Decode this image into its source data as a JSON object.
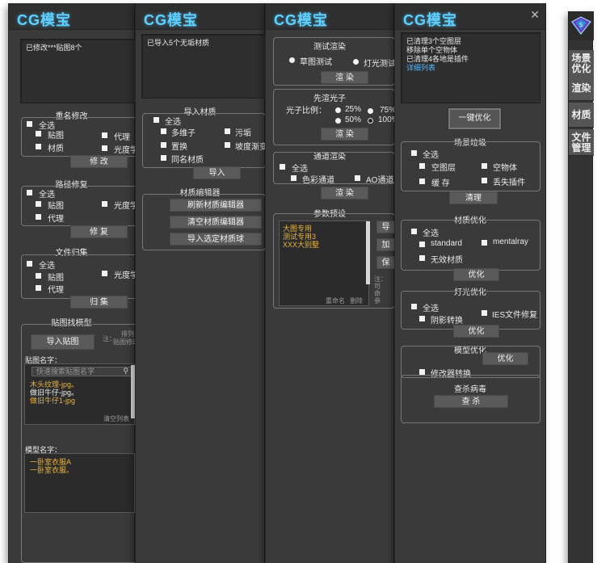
{
  "brand": {
    "logo_text": "CG模宝"
  },
  "panel1": {
    "log": "已修改***贴图8个",
    "rename": {
      "title": "重名修改",
      "select_all": "全选",
      "items": [
        "贴图",
        "代理",
        "材质",
        "光度学"
      ],
      "button": "修 改"
    },
    "path_repair": {
      "title": "路径修复",
      "select_all": "全选",
      "items": [
        "贴图",
        "光度学",
        "代理"
      ],
      "button": "修 复"
    },
    "file_collect": {
      "title": "文件归集",
      "select_all": "全选",
      "items": [
        "贴图",
        "光度学",
        "代理"
      ],
      "button": "归 集"
    },
    "find_model": {
      "title": "贴图找模型",
      "import_button": "导入贴图",
      "note1": "注：",
      "note2": "排列",
      "note3": "贴图修改",
      "map_name_label": "贴图名字：",
      "search_placeholder": "快速搜索贴图名字",
      "maps": [
        {
          "name": "木头纹理-jpg。",
          "style": "yel"
        },
        {
          "name": "做旧牛仔-jpg。",
          "style": "wht"
        },
        {
          "name": "做旧牛仔1-jpg",
          "style": "yel"
        }
      ],
      "clear_list": "清空列表",
      "model_name_label": "模型名字：",
      "models": [
        "一卧室衣服A",
        "一卧室衣服。"
      ]
    }
  },
  "panel2": {
    "log": "已导入5个无垢材质",
    "import_mat": {
      "title": "导入材质",
      "select_all": "全选",
      "items": [
        "多维子",
        "污垢",
        "置换",
        "坡度渐变",
        "同名材质"
      ],
      "button": "导入"
    },
    "mat_editor": {
      "title": "材质编辑器",
      "buttons": [
        "刷新材质编辑器",
        "清空材质编辑器",
        "导入选定材质球"
      ]
    }
  },
  "panel3": {
    "test_render": {
      "title": "测试渲染",
      "options": [
        "草图测试",
        "灯光测试"
      ],
      "button": "渲 染"
    },
    "photon": {
      "title": "先渲光子",
      "ratio_label": "光子比例：",
      "options": [
        "25%",
        "75%",
        "50%",
        "100%"
      ],
      "button": "渲 染"
    },
    "channel": {
      "title": "通道渲染",
      "select_all": "全选",
      "items": [
        "色彩通道",
        "AO通道"
      ],
      "button": "渲 染"
    },
    "preset": {
      "title": "参数预设",
      "items": [
        "大图专用",
        "测试专用3",
        "XXX大别墅"
      ],
      "rename": "重命名",
      "delete": "删除",
      "side_buttons": [
        "导",
        "加",
        "保"
      ],
      "side_note": [
        "注：",
        "可",
        "命",
        "参"
      ]
    }
  },
  "panel4": {
    "log": [
      "已清理3个空图层",
      "移除单个空物体",
      "已清理4各地是插件"
    ],
    "log_link": "详细列表",
    "optimize_button": "一键优化",
    "trash": {
      "title": "场景垃圾",
      "select_all": "全选",
      "items": [
        "空图层",
        "空物体",
        "缓 存",
        "丢失插件"
      ],
      "button": "清理"
    },
    "mat_opt": {
      "title": "材质优化",
      "select_all": "全选",
      "items": [
        "standard",
        "mentalray",
        "无效材质"
      ],
      "button": "优化"
    },
    "light_opt": {
      "title": "灯光优化",
      "select_all": "全选",
      "items": [
        "阴影转换",
        "IES文件修复"
      ],
      "button": "优化"
    },
    "model_opt": {
      "title": "模型优化",
      "item": "修改器转换",
      "button": "优化"
    },
    "virus": {
      "title": "查杀病毒",
      "button": "查 杀"
    }
  },
  "sidebar": {
    "tabs": [
      "场景\n优化",
      "渲染",
      "材质",
      "文件\n管理"
    ]
  }
}
